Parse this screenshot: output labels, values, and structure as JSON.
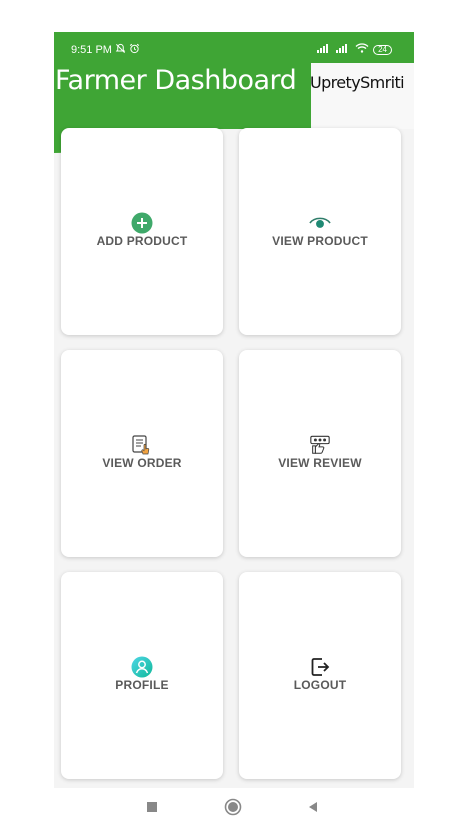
{
  "status_bar": {
    "time": "9:51 PM",
    "battery": "24"
  },
  "header": {
    "title": "Farmer Dashboard",
    "username": "UpretySmriti"
  },
  "cards": [
    {
      "label": "ADD PRODUCT",
      "icon": "add-circle-icon"
    },
    {
      "label": "VIEW PRODUCT",
      "icon": "eye-icon"
    },
    {
      "label": "VIEW ORDER",
      "icon": "order-icon"
    },
    {
      "label": "VIEW REVIEW",
      "icon": "review-icon"
    },
    {
      "label": "PROFILE",
      "icon": "profile-icon"
    },
    {
      "label": "LOGOUT",
      "icon": "logout-icon"
    }
  ],
  "colors": {
    "accent_green": "#3fa535",
    "card_label": "#5a5a5a"
  },
  "nav_bar": {
    "buttons": [
      "recent-apps-button",
      "home-button",
      "back-button"
    ]
  }
}
